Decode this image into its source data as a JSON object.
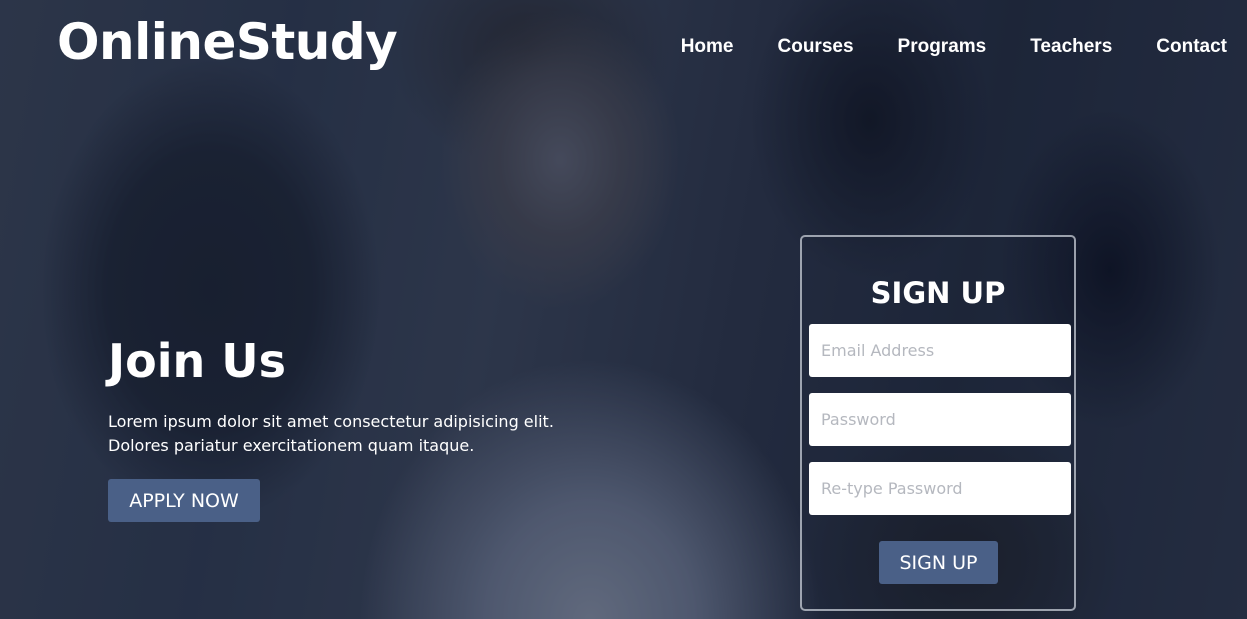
{
  "brand": {
    "logo_text": "OnlineStudy"
  },
  "nav": {
    "items": [
      "Home",
      "Courses",
      "Programs",
      "Teachers",
      "Contact"
    ]
  },
  "hero": {
    "title": "Join Us",
    "text": "Lorem ipsum dolor sit amet consectetur adipisicing elit. Dolores pariatur exercitationem quam itaque.",
    "apply_label": "APPLY NOW"
  },
  "signup": {
    "title": "SIGN UP",
    "email_placeholder": "Email Address",
    "password_placeholder": "Password",
    "retype_placeholder": "Re-type Password",
    "button_label": "SIGN UP"
  },
  "colors": {
    "button": "#4a6087",
    "text": "#ffffff",
    "overlay": "#1c2236"
  }
}
